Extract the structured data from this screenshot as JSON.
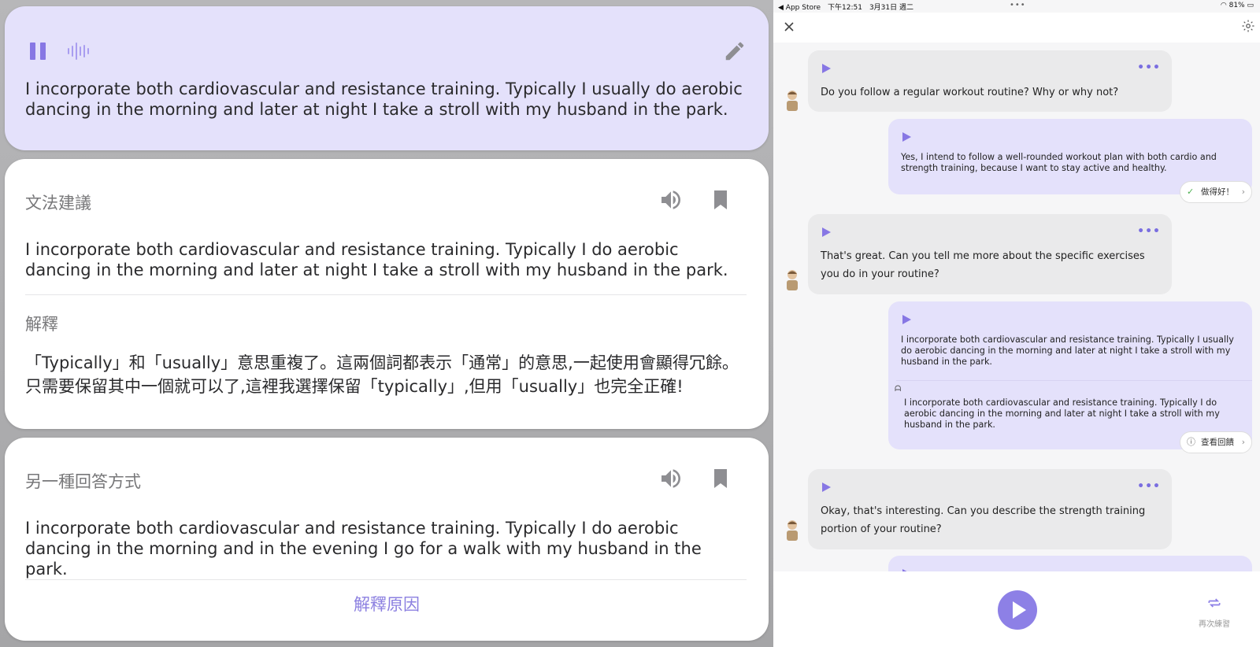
{
  "left": {
    "user_card": {
      "text": "I incorporate both cardiovascular and resistance training. Typically I usually do aerobic dancing in the morning and later at night I take a stroll with my husband in the park."
    },
    "grammar_card": {
      "title": "文法建議",
      "corrected": "I incorporate both cardiovascular and resistance training. Typically I do aerobic dancing in the morning and later at night I take a stroll with my husband in the park.",
      "explain_title": "解釋",
      "explanation": "「Typically」和「usually」意思重複了。這兩個詞都表示「通常」的意思,一起使用會顯得冗餘。只需要保留其中一個就可以了,這裡我選擇保留「typically」,但用「usually」也完全正確!"
    },
    "alt_card": {
      "title": "另一種回答方式",
      "text": "I incorporate both cardiovascular and resistance training. Typically I do aerobic dancing in the morning and in the evening I go for a walk with my husband in the park.",
      "link": "解釋原因"
    }
  },
  "right": {
    "status": {
      "left": "◀ App Store　下午12:51　3月31日 週二",
      "dots": "•••",
      "right": "81%"
    },
    "messages": {
      "m1": "Do you follow a regular workout routine? Why or why not?",
      "m2": "Yes, I intend to follow a well-rounded workout plan with both cardio and strength training, because I want to stay active and healthy.",
      "m2_pill": "做得好！",
      "m3": "That's great. Can you tell me more about the specific exercises you do in your routine?",
      "m4": "I incorporate both cardiovascular and resistance training. Typically I usually do aerobic dancing in the morning and later at night I take a stroll with my husband in the park.",
      "m4_corrected": "I incorporate both cardiovascular and resistance training. Typically I do aerobic dancing in the morning and later at night I take a stroll with my husband in the park.",
      "m4_pill": "查看回饋",
      "m5": "Okay, that's interesting. Can you describe the strength training portion of your routine?",
      "more": "•••"
    },
    "bottom": {
      "retry_label": "再次練習"
    }
  },
  "colors": {
    "accent": "#8d80e6",
    "user_bubble": "#e4e1fb",
    "ai_bubble": "#eaeaeb"
  }
}
